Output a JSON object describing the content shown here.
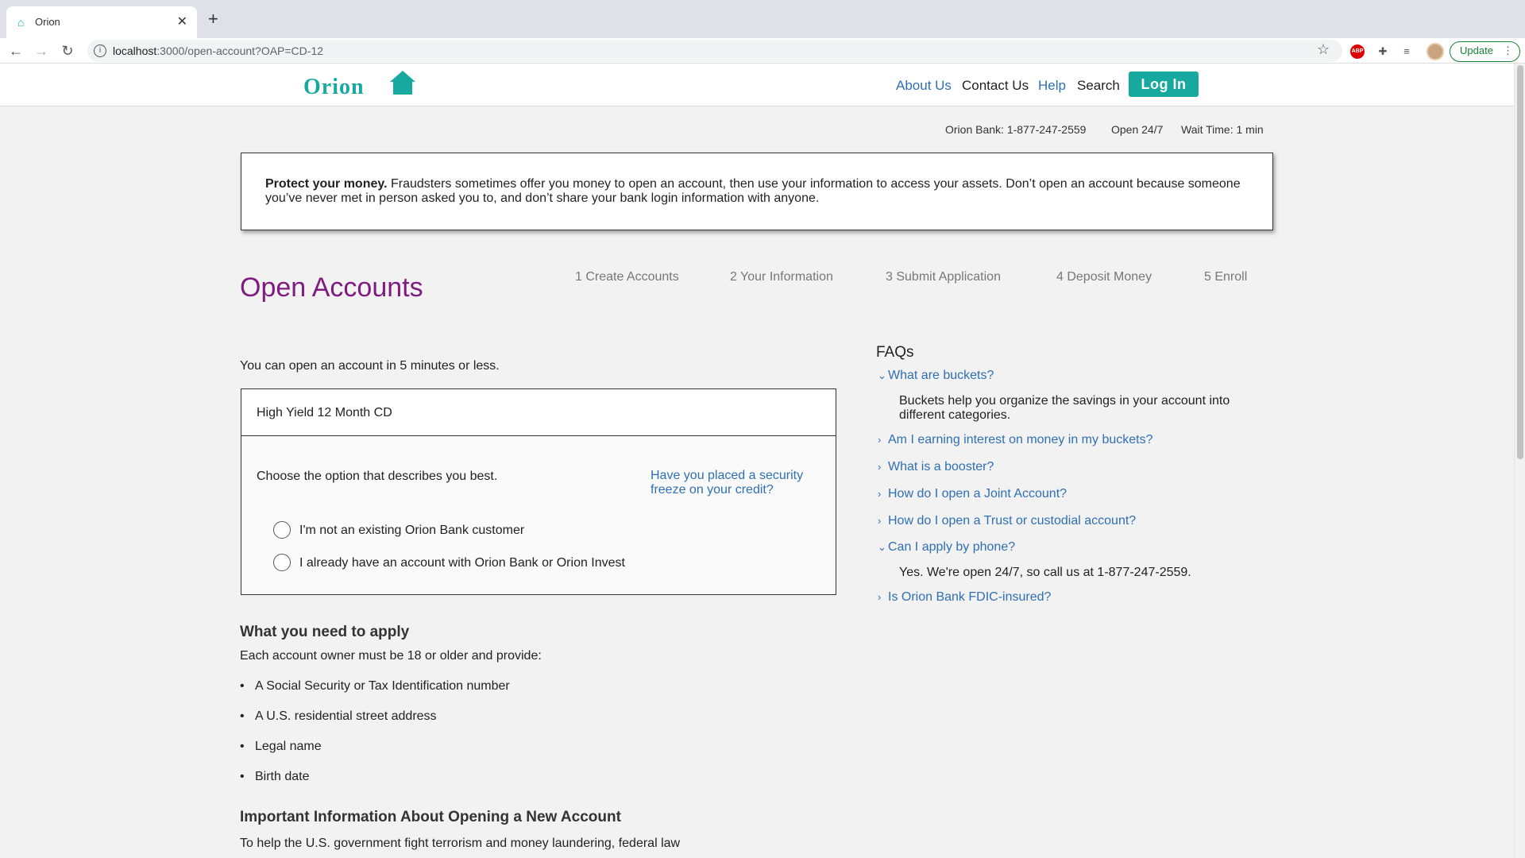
{
  "browser": {
    "tab_title": "Orion",
    "url_host": "localhost",
    "url_path": ":3000/open-account?OAP=CD-12",
    "update_label": "Update",
    "abp_label": "ABP"
  },
  "header": {
    "logo_text": "Orion",
    "nav": {
      "about": "About Us",
      "contact": "Contact Us",
      "help": "Help",
      "search": "Search"
    },
    "login_label": "Log In"
  },
  "infobar": {
    "phone": "Orion Bank: 1-877-247-2559",
    "open": "Open 24/7",
    "wait": "Wait Time: 1 min"
  },
  "notice": {
    "bold": "Protect your money.",
    "text": " Fraudsters sometimes offer you money to open an account, then use your information to access your assets. Don’t open an account because someone you’ve never met in person asked you to, and don’t share your bank login information with anyone."
  },
  "page": {
    "title": "Open Accounts",
    "steps": [
      "1 Create Accounts",
      "2 Your Information",
      "3 Submit Application",
      "4 Deposit Money",
      "5 Enroll"
    ],
    "intro": "You can open an account in 5 minutes or less."
  },
  "account_card": {
    "product": "High Yield 12 Month CD",
    "choose": "Choose the option that describes you best.",
    "freeze_link": "Have you placed a security freeze on your credit?",
    "options": [
      "I'm not an existing Orion Bank customer",
      "I already have an account with Orion Bank or Orion Invest"
    ]
  },
  "requirements": {
    "title": "What you need to apply",
    "subtitle": "Each account owner must be 18 or older and provide:",
    "items": [
      "A Social Security or Tax Identification number",
      "A U.S. residential street address",
      "Legal name",
      "Birth date"
    ]
  },
  "important": {
    "title": "Important Information About Opening a New Account",
    "text": "To help the U.S. government fight terrorism and money laundering, federal law"
  },
  "faq": {
    "title": "FAQs",
    "items": [
      {
        "q": "What are buckets?",
        "open": true,
        "a": "Buckets help you organize the savings in your account into different categories."
      },
      {
        "q": "Am I earning interest on money in my buckets?",
        "open": false
      },
      {
        "q": "What is a booster?",
        "open": false
      },
      {
        "q": "How do I open a Joint Account?",
        "open": false
      },
      {
        "q": "How do I open a Trust or custodial account?",
        "open": false
      },
      {
        "q": "Can I apply by phone?",
        "open": true,
        "a": "Yes. We're open 24/7, so call us at 1-877-247-2559."
      },
      {
        "q": "Is Orion Bank FDIC-insured?",
        "open": false
      }
    ]
  },
  "colors": {
    "brand": "#17a99f",
    "title": "#7d1b7e",
    "link": "#2f6fb3"
  }
}
